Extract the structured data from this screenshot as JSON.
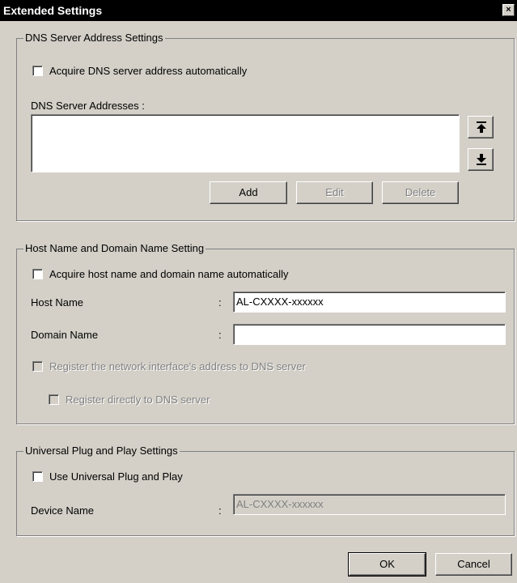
{
  "window": {
    "title": "Extended Settings",
    "close_glyph": "×"
  },
  "dns": {
    "legend": "DNS Server Address Settings",
    "auto_label": "Acquire DNS server address automatically",
    "auto_checked": false,
    "addresses_label": "DNS Server Addresses :",
    "addresses": [],
    "buttons": {
      "add": "Add",
      "edit": "Edit",
      "delete": "Delete"
    },
    "icons": {
      "up": "move-up-icon",
      "down": "move-down-icon"
    }
  },
  "host": {
    "legend": "Host Name and Domain Name Setting",
    "auto_label": "Acquire host name and domain name automatically",
    "auto_checked": false,
    "host_name_label": "Host Name",
    "host_name_value": "AL-CXXXX-xxxxxx",
    "domain_name_label": "Domain Name",
    "domain_name_value": "",
    "colon": ":",
    "register_label": "Register the network interface's address to DNS server",
    "register_direct_label": "Register directly to DNS server"
  },
  "upnp": {
    "legend": "Universal Plug and Play Settings",
    "use_label": "Use Universal Plug and Play",
    "use_checked": false,
    "device_name_label": "Device Name",
    "device_name_value": "AL-CXXXX-xxxxxx",
    "colon": ":"
  },
  "footer": {
    "ok": "OK",
    "cancel": "Cancel"
  },
  "colors": {
    "dialog_bg": "#d4d0c8",
    "titlebar_bg": "#000000",
    "disabled_text": "#808080"
  }
}
